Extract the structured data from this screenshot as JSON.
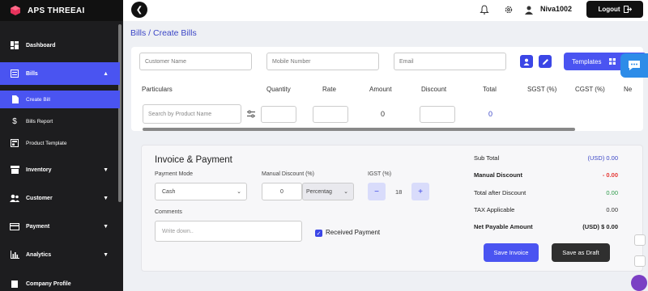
{
  "brand": {
    "name": "APS THREEAI",
    "logo_icon": "cube-logo-icon",
    "accent": "#e6335c"
  },
  "sidebar": {
    "items": [
      {
        "label": "Dashboard",
        "icon": "dashboard-icon"
      },
      {
        "label": "Bills",
        "icon": "bills-icon"
      },
      {
        "label": "Create Bill",
        "icon": "document-icon"
      },
      {
        "label": "Bills Report",
        "icon": "dollar-icon"
      },
      {
        "label": "Product Template",
        "icon": "template-icon"
      },
      {
        "label": "Inventory",
        "icon": "inventory-icon"
      },
      {
        "label": "Customer",
        "icon": "users-icon"
      },
      {
        "label": "Payment",
        "icon": "card-icon"
      },
      {
        "label": "Analytics",
        "icon": "chart-icon"
      },
      {
        "label": "Company Profile",
        "icon": "building-icon"
      }
    ],
    "active_color": "#4a54f1"
  },
  "topbar": {
    "user": "Niva1002",
    "logout_label": "Logout"
  },
  "breadcrumb": "Bills / Create Bills",
  "customer": {
    "name_placeholder": "Customer Name",
    "mobile_placeholder": "Mobile Number",
    "email_placeholder": "Email",
    "templates_label": "Templates"
  },
  "table": {
    "headers": [
      "Particulars",
      "Quantity",
      "Rate",
      "Amount",
      "Discount",
      "Total",
      "SGST (%)",
      "CGST (%)",
      "Ne"
    ],
    "search_placeholder": "Search by Product Name",
    "amount": "0",
    "total": "0"
  },
  "invoice": {
    "title": "Invoice & Payment",
    "payment_mode_label": "Payment Mode",
    "payment_mode_value": "Cash",
    "manual_discount_label": "Manual Discount (%)",
    "manual_discount_value": "0",
    "discount_type": "Percentag",
    "igst_label": "IGST (%)",
    "igst_value": "18",
    "comments_label": "Comments",
    "comments_placeholder": "Write down..",
    "received_payment_label": "Received Payment",
    "save_invoice_label": "Save Invoice",
    "save_draft_label": "Save as Draft"
  },
  "summary": [
    {
      "label": "Sub Total",
      "value": "(USD) 0.00",
      "color": "#3b46c6",
      "bold": false
    },
    {
      "label": "Manual Discount",
      "value": "- 0.00",
      "color": "#e53935",
      "bold": true
    },
    {
      "label": "Total after Discount",
      "value": "0.00",
      "color": "#2e9a4a",
      "bold": false
    },
    {
      "label": "TAX Applicable",
      "value": "0.00",
      "color": "#333333",
      "bold": false
    },
    {
      "label": "Net Payable Amount",
      "value": "(USD) $ 0.00",
      "color": "#222222",
      "bold": true
    }
  ]
}
